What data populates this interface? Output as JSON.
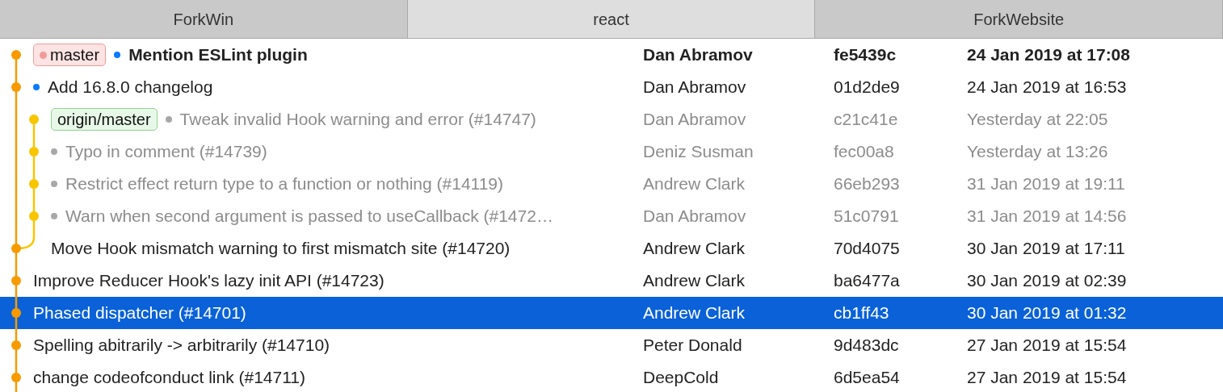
{
  "tabs": [
    {
      "label": "ForkWin",
      "selected": false
    },
    {
      "label": "react",
      "selected": true
    },
    {
      "label": "ForkWebsite",
      "selected": false
    }
  ],
  "commits": [
    {
      "kind": "head",
      "tags": [
        {
          "label": "master",
          "kind": "local"
        }
      ],
      "color": "#0a7aff",
      "message": "Mention ESLint plugin",
      "author": "Dan Abramov",
      "hash": "fe5439c",
      "date": "24 Jan 2019 at 17:08",
      "bold": true,
      "dimmed": false,
      "selected": false
    },
    {
      "kind": "main",
      "color": "#0a7aff",
      "message": "Add 16.8.0 changelog",
      "author": "Dan Abramov",
      "hash": "01d2de9",
      "date": "24 Jan 2019 at 16:53",
      "bold": false,
      "dimmed": false,
      "selected": false
    },
    {
      "kind": "branchhead",
      "tags": [
        {
          "label": "origin/master",
          "kind": "remote"
        }
      ],
      "color": "#a8a8a8",
      "message": "Tweak invalid Hook warning and error (#14747)",
      "author": "Dan Abramov",
      "hash": "c21c41e",
      "date": "Yesterday at 22:05",
      "bold": false,
      "dimmed": true,
      "selected": false
    },
    {
      "kind": "branch",
      "color": "#a8a8a8",
      "message": "Typo in comment (#14739)",
      "author": "Deniz Susman",
      "hash": "fec00a8",
      "date": "Yesterday at 13:26",
      "bold": false,
      "dimmed": true,
      "selected": false
    },
    {
      "kind": "branch",
      "color": "#a8a8a8",
      "message": "Restrict effect return type to a function or nothing (#14119)",
      "author": "Andrew Clark",
      "hash": "66eb293",
      "date": "31 Jan 2019 at 19:11",
      "bold": false,
      "dimmed": true,
      "selected": false
    },
    {
      "kind": "branch",
      "color": "#a8a8a8",
      "message": "Warn when second argument is passed to useCallback (#1472…",
      "author": "Dan Abramov",
      "hash": "51c0791",
      "date": "31 Jan 2019 at 14:56",
      "bold": false,
      "dimmed": true,
      "selected": false
    },
    {
      "kind": "merge",
      "message": "Move Hook mismatch warning to first mismatch site (#14720)",
      "author": "Andrew Clark",
      "hash": "70d4075",
      "date": "30 Jan 2019 at 17:11",
      "bold": false,
      "dimmed": false,
      "selected": false
    },
    {
      "kind": "main",
      "message": "Improve Reducer Hook's lazy init API (#14723)",
      "author": "Andrew Clark",
      "hash": "ba6477a",
      "date": "30 Jan 2019 at 02:39",
      "bold": false,
      "dimmed": false,
      "selected": false
    },
    {
      "kind": "main",
      "message": "Phased dispatcher (#14701)",
      "author": "Andrew Clark",
      "hash": "cb1ff43",
      "date": "30 Jan 2019 at 01:32",
      "bold": false,
      "dimmed": false,
      "selected": true
    },
    {
      "kind": "main",
      "message": "Spelling abitrarily -> arbitrarily (#14710)",
      "author": "Peter Donald",
      "hash": "9d483dc",
      "date": "27 Jan 2019 at 15:54",
      "bold": false,
      "dimmed": false,
      "selected": false
    },
    {
      "kind": "main",
      "message": "change codeofconduct link (#14711)",
      "author": "DeepCold",
      "hash": "6d5ea54",
      "date": "27 Jan 2019 at 15:54",
      "bold": false,
      "dimmed": false,
      "selected": false
    }
  ]
}
